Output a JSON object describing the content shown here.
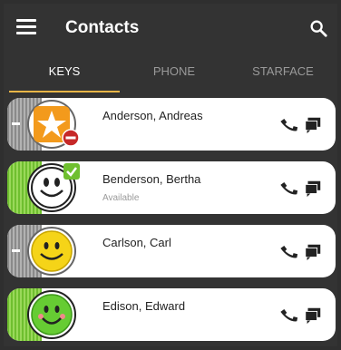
{
  "app_bar": {
    "title": "Contacts",
    "menu_icon": "hamburger-menu-icon",
    "search_icon": "search-icon"
  },
  "tabs": [
    {
      "label": "KEYS",
      "active": true
    },
    {
      "label": "PHONE",
      "active": false
    },
    {
      "label": "STARFACE",
      "active": false
    }
  ],
  "colors": {
    "background": "#333333",
    "tab_indicator": "#e8b547",
    "busy": "#c62828",
    "available": "#6fbf2f",
    "offline_edge": "#9a9a9a"
  },
  "contacts": [
    {
      "name": "Anderson, Andreas",
      "status": "",
      "presence": "busy",
      "avatar": "starface-logo-icon",
      "badge": "do-not-disturb-icon"
    },
    {
      "name": "Benderson, Bertha",
      "status": "Available",
      "presence": "available",
      "avatar": "smiley-outline-icon",
      "badge": "checkmark-icon"
    },
    {
      "name": "Carlson, Carl",
      "status": "",
      "presence": "offline",
      "avatar": "yellow-smiley-icon",
      "badge": ""
    },
    {
      "name": "Edison, Edward",
      "status": "",
      "presence": "available",
      "avatar": "green-smiley-icon",
      "badge": ""
    }
  ]
}
